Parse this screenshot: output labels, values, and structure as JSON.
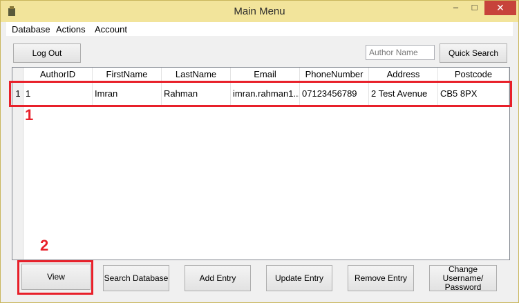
{
  "window": {
    "title": "Main Menu",
    "minimize_glyph": "–",
    "maximize_glyph": "□",
    "close_glyph": "✕"
  },
  "menu": [
    "Database",
    "Actions",
    "Account"
  ],
  "toolbar": {
    "logout_label": "Log Out",
    "author_search_placeholder": "Author Name",
    "author_search_value": "",
    "quick_search_label": "Quick Search"
  },
  "table": {
    "columns": [
      "AuthorID",
      "FirstName",
      "LastName",
      "Email",
      "PhoneNumber",
      "Address",
      "Postcode"
    ],
    "rows": [
      {
        "row_number": "1",
        "cells": [
          "1",
          "Imran",
          "Rahman",
          "imran.rahman1...",
          "07123456789",
          "2 Test Avenue",
          "CB5 8PX"
        ]
      }
    ]
  },
  "buttons": {
    "view": "View",
    "search_database": "Search Database",
    "add_entry": "Add Entry",
    "update_entry": "Update Entry",
    "remove_entry": "Remove Entry",
    "change_credentials": "Change Username/ Password"
  },
  "annotations": {
    "first": "1",
    "second": "2",
    "color": "#e8202a"
  }
}
